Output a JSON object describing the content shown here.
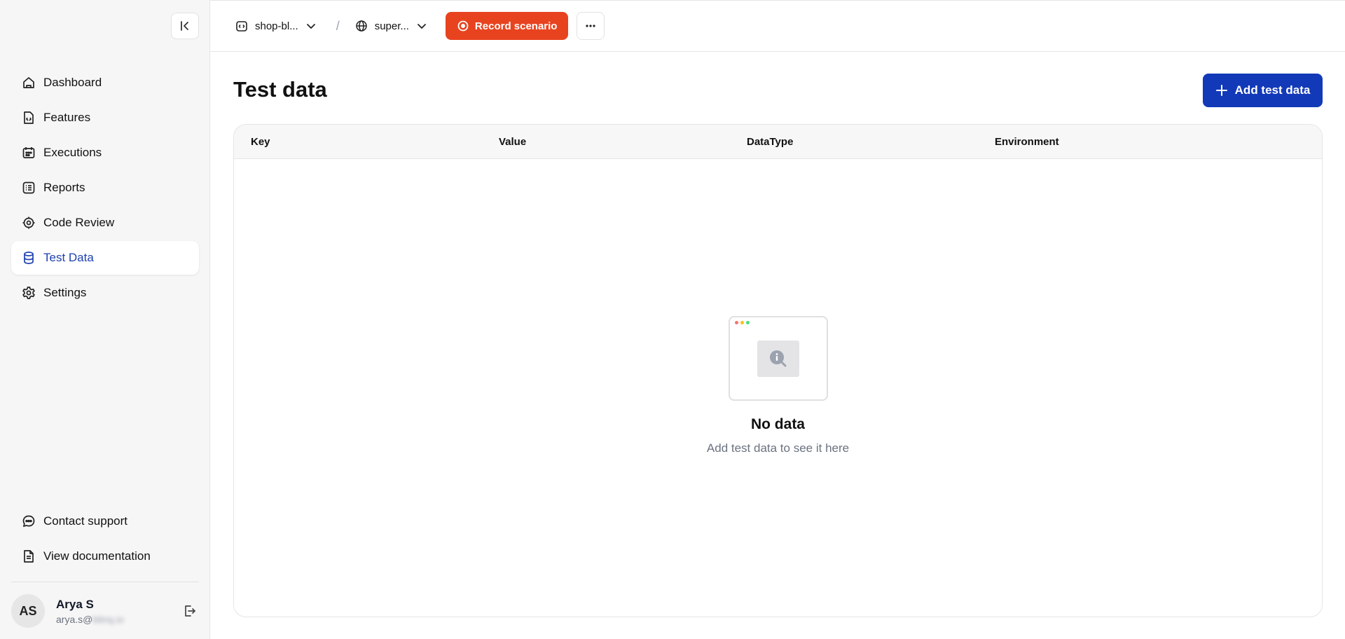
{
  "sidebar": {
    "nav": [
      {
        "label": "Dashboard",
        "icon": "home-icon"
      },
      {
        "label": "Features",
        "icon": "feature-file-icon"
      },
      {
        "label": "Executions",
        "icon": "calendar-icon"
      },
      {
        "label": "Reports",
        "icon": "list-report-icon"
      },
      {
        "label": "Code Review",
        "icon": "gear-outline-icon"
      },
      {
        "label": "Test Data",
        "icon": "database-icon",
        "active": true
      },
      {
        "label": "Settings",
        "icon": "settings-icon"
      }
    ],
    "bottom": [
      {
        "label": "Contact support",
        "icon": "chat-icon"
      },
      {
        "label": "View documentation",
        "icon": "document-icon"
      }
    ],
    "user": {
      "initials": "AS",
      "name": "Arya S",
      "email_visible": "arya.s@",
      "email_blurred": "blinq.io"
    }
  },
  "topbar": {
    "project": "shop-bl...",
    "separator": "/",
    "environment": "super...",
    "record_label": "Record scenario"
  },
  "main": {
    "title": "Test data",
    "add_label": "Add test data",
    "columns": [
      "Key",
      "Value",
      "DataType",
      "Environment"
    ],
    "empty_title": "No data",
    "empty_subtitle": "Add test data to see it here"
  },
  "colors": {
    "accent": "#1239b8",
    "record": "#e8431f",
    "active_nav": "#1e40af"
  }
}
